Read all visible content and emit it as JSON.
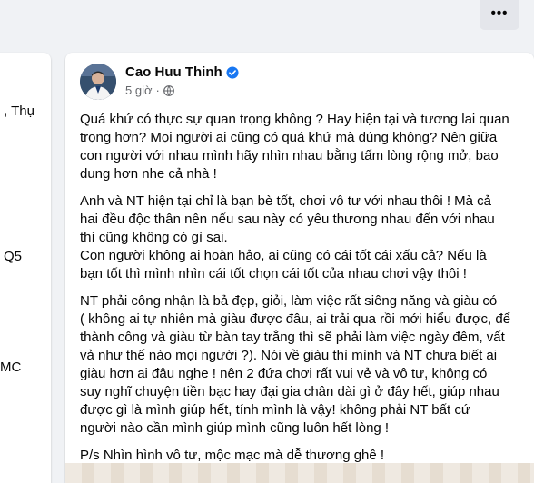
{
  "header": {
    "more_label": "•••"
  },
  "left_panel": {
    "fragments": [
      ", Thụ",
      "Q5",
      "MC"
    ]
  },
  "post": {
    "author": "Cao Huu Thinh",
    "time": "5 giờ",
    "paragraphs": [
      [
        "Quá khứ có thực sự quan trọng không ? Hay hiện tại và tương lai quan",
        "trọng hơn? Mọi người ai cũng có quá khứ mà đúng không? Nên giữa",
        "con người với nhau mình hãy nhìn nhau bằng tấm lòng rộng mở, bao",
        "dung hơn nhe cả nhà !"
      ],
      [
        "Anh và NT hiện tại chỉ là bạn bè tốt, chơi vô tư với nhau thôi ! Mà cả",
        "hai đều độc thân nên nếu sau này có yêu thương nhau đến với nhau",
        "thì cũng không có gì sai.",
        "Con người không ai hoàn hảo, ai cũng có cái tốt cái xấu cả? Nếu là",
        "bạn tốt thì mình nhìn cái tốt chọn cái tốt của nhau chơi vậy thôi !"
      ],
      [
        "NT phải công nhận là bả đẹp, giỏi, làm việc rất siêng năng và giàu có",
        "( không ai tự nhiên mà giàu được đâu, ai trải qua rồi mới hiểu được, để",
        "thành công và giàu từ bàn tay trắng thì sẽ phải làm việc ngày đêm, vất",
        "vả như thế nào mọi người ?). Nói về giàu thì mình và NT chưa biết ai",
        "giàu hơn ai đâu nghe ! nên 2 đứa chơi rất vui vẻ và vô tư, không có",
        "suy nghĩ chuyện tiền bạc hay đại gia chân dài gì ở đây hết, giúp nhau",
        "được gì là mình giúp hết, tính mình là vậy! không phải NT bất cứ",
        "người nào cần mình giúp mình cũng luôn hết lòng !"
      ],
      [
        "P/s Nhìn hình vô tư, mộc mạc mà dễ thương ghê !"
      ]
    ]
  },
  "colors": {
    "background": "#f0f2f5",
    "card": "#ffffff",
    "verified": "#1877f2",
    "meta_text": "#65676b"
  },
  "icons": [
    "more-options-icon",
    "verified-badge-icon",
    "globe-icon"
  ]
}
